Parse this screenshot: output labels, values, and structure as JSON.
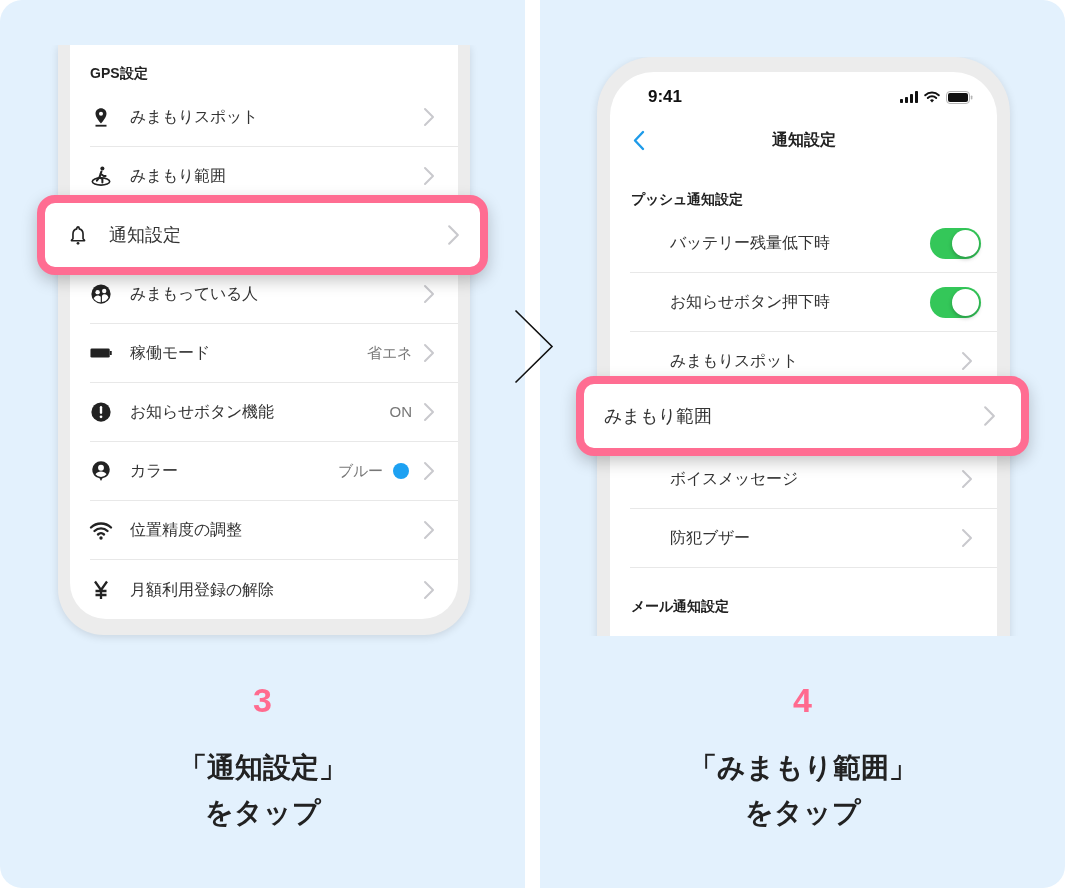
{
  "steps": [
    {
      "number": "3",
      "instruction_lines": [
        "「通知設定」",
        "をタップ"
      ],
      "screen": {
        "kind": "settings_list",
        "section_title": "GPS設定",
        "items": [
          {
            "label": "みまもりスポット",
            "highlighted": false
          },
          {
            "label": "みまもり範囲",
            "highlighted": false
          },
          {
            "label": "通知設定",
            "highlighted": true
          },
          {
            "label": "みまもっている人",
            "highlighted": false
          },
          {
            "label": "稼働モード",
            "value": "省エネ",
            "highlighted": false
          },
          {
            "label": "お知らせボタン機能",
            "value": "ON",
            "highlighted": false
          },
          {
            "label": "カラー",
            "value": "ブルー",
            "color": "#1da1f2",
            "highlighted": false
          },
          {
            "label": "位置精度の調整",
            "highlighted": false
          },
          {
            "label": "月額利用登録の解除",
            "highlighted": false
          }
        ]
      }
    },
    {
      "number": "4",
      "instruction_lines": [
        "「みまもり範囲」",
        "をタップ"
      ],
      "screen": {
        "kind": "notification_settings",
        "status_bar": {
          "time": "9:41"
        },
        "title": "通知設定",
        "sections": [
          {
            "title": "プッシュ通知設定",
            "items": [
              {
                "kind": "toggle",
                "label": "バッテリー残量低下時",
                "on": true,
                "highlighted": false
              },
              {
                "kind": "toggle",
                "label": "お知らせボタン押下時",
                "on": true,
                "highlighted": false
              },
              {
                "kind": "link",
                "label": "みまもりスポット",
                "highlighted": false
              },
              {
                "kind": "link",
                "label": "みまもり範囲",
                "highlighted": true
              },
              {
                "kind": "link",
                "label": "ボイスメッセージ",
                "highlighted": false
              },
              {
                "kind": "link",
                "label": "防犯ブザー",
                "highlighted": false
              }
            ]
          },
          {
            "title": "メール通知設定"
          }
        ]
      }
    }
  ]
}
